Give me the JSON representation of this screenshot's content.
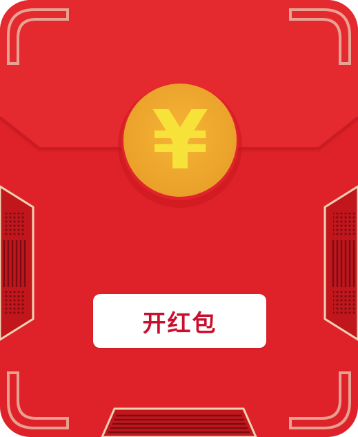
{
  "envelope": {
    "coin_symbol": "¥",
    "open_button_label": "开红包",
    "colors": {
      "body_red": "#df2229",
      "flap_red": "#e32a2f",
      "trim_gold": "#e9c9a2",
      "coin_gold": "#efa82e",
      "symbol_yellow": "#f7e23a",
      "button_text": "#c8102e"
    }
  }
}
